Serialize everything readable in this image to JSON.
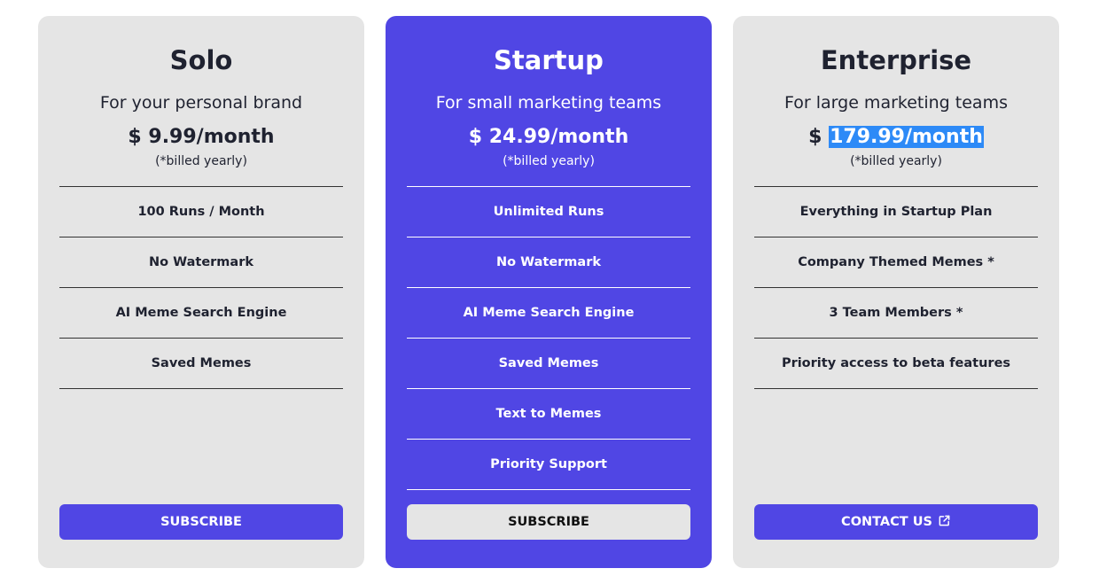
{
  "plans": [
    {
      "name": "Solo",
      "tagline": "For your personal brand",
      "currency": "$",
      "price": "9.99/month",
      "billing_note": "(*billed yearly)",
      "features": [
        "100 Runs / Month",
        "No Watermark",
        "AI Meme Search Engine",
        "Saved Memes"
      ],
      "button_label": "SUBSCRIBE"
    },
    {
      "name": "Startup",
      "tagline": "For small marketing teams",
      "currency": "$",
      "price": "24.99/month",
      "billing_note": "(*billed yearly)",
      "features": [
        "Unlimited Runs",
        "No Watermark",
        "AI Meme Search Engine",
        "Saved Memes",
        "Text to Memes",
        "Priority Support"
      ],
      "button_label": "SUBSCRIBE"
    },
    {
      "name": "Enterprise",
      "tagline": "For large marketing teams",
      "currency": "$",
      "price": "179.99/month",
      "billing_note": "(*billed yearly)",
      "features": [
        "Everything in Startup Plan",
        "Company Themed Memes *",
        "3 Team Members *",
        "Priority access to beta features"
      ],
      "button_label": "CONTACT US",
      "button_icon": "external-link-icon",
      "price_text_selected": true
    }
  ],
  "colors": {
    "accent": "#5046e4",
    "card_bg": "#e5e5e5",
    "selection": "#2d8af7"
  }
}
